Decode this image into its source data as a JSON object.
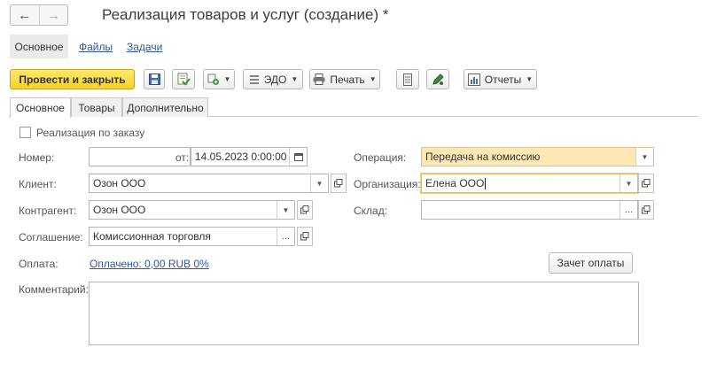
{
  "window": {
    "title": "Реализация товаров и услуг (создание) *",
    "nav_back": "←",
    "nav_forward": "→"
  },
  "panel": {
    "tabs": [
      {
        "label": "Основное"
      },
      {
        "label": "Файлы"
      },
      {
        "label": "Задачи"
      }
    ]
  },
  "toolbar": {
    "post_close": "Провести и закрыть",
    "edo": "ЭДО",
    "print": "Печать",
    "reports": "Отчеты"
  },
  "tabs": [
    {
      "label": "Основное"
    },
    {
      "label": "Товары"
    },
    {
      "label": "Дополнительно"
    }
  ],
  "form": {
    "by_order_label": "Реализация по заказу",
    "number_label": "Номер:",
    "number_value": "",
    "date_label": "от:",
    "date_value": "14.05.2023  0:00:00",
    "client_label": "Клиент:",
    "client_value": "Озон ООО",
    "counterparty_label": "Контрагент:",
    "counterparty_value": "Озон ООО",
    "agreement_label": "Соглашение:",
    "agreement_value": "Комиссионная торговля",
    "payment_label": "Оплата:",
    "payment_link": "Оплачено: 0,00 RUB  0%",
    "comment_label": "Комментарий:",
    "comment_value": "",
    "operation_label": "Операция:",
    "operation_value": "Передача на комиссию",
    "organization_label": "Организация:",
    "organization_value": "Елена ООО",
    "warehouse_label": "Склад:",
    "warehouse_value": "",
    "offset_button": "Зачет оплаты"
  },
  "colors": {
    "primary_button": "#f5d22a",
    "link": "#2a56a6",
    "operation_highlight": "#fde7b4"
  }
}
